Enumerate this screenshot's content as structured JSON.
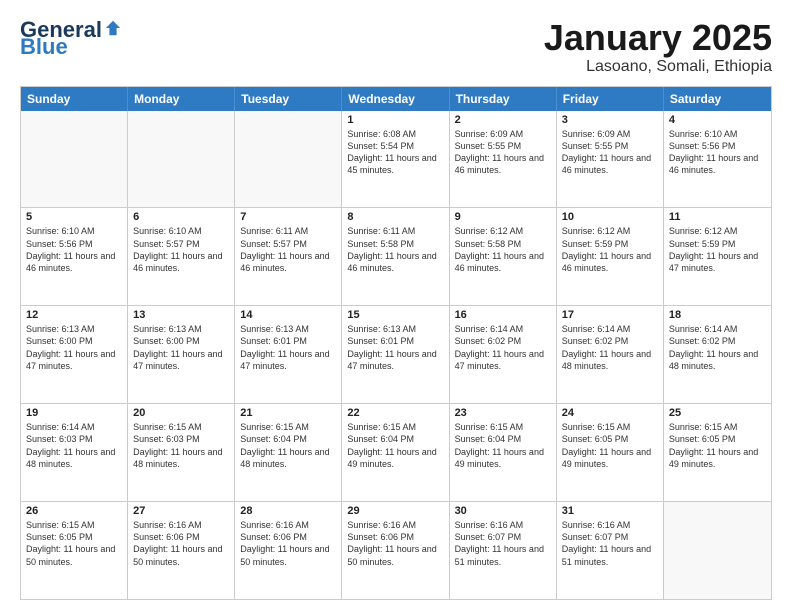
{
  "logo": {
    "general": "General",
    "blue": "Blue"
  },
  "header": {
    "month": "January 2025",
    "location": "Lasoano, Somali, Ethiopia"
  },
  "days": [
    "Sunday",
    "Monday",
    "Tuesday",
    "Wednesday",
    "Thursday",
    "Friday",
    "Saturday"
  ],
  "rows": [
    [
      {
        "day": "",
        "info": ""
      },
      {
        "day": "",
        "info": ""
      },
      {
        "day": "",
        "info": ""
      },
      {
        "day": "1",
        "info": "Sunrise: 6:08 AM\nSunset: 5:54 PM\nDaylight: 11 hours and 45 minutes."
      },
      {
        "day": "2",
        "info": "Sunrise: 6:09 AM\nSunset: 5:55 PM\nDaylight: 11 hours and 46 minutes."
      },
      {
        "day": "3",
        "info": "Sunrise: 6:09 AM\nSunset: 5:55 PM\nDaylight: 11 hours and 46 minutes."
      },
      {
        "day": "4",
        "info": "Sunrise: 6:10 AM\nSunset: 5:56 PM\nDaylight: 11 hours and 46 minutes."
      }
    ],
    [
      {
        "day": "5",
        "info": "Sunrise: 6:10 AM\nSunset: 5:56 PM\nDaylight: 11 hours and 46 minutes."
      },
      {
        "day": "6",
        "info": "Sunrise: 6:10 AM\nSunset: 5:57 PM\nDaylight: 11 hours and 46 minutes."
      },
      {
        "day": "7",
        "info": "Sunrise: 6:11 AM\nSunset: 5:57 PM\nDaylight: 11 hours and 46 minutes."
      },
      {
        "day": "8",
        "info": "Sunrise: 6:11 AM\nSunset: 5:58 PM\nDaylight: 11 hours and 46 minutes."
      },
      {
        "day": "9",
        "info": "Sunrise: 6:12 AM\nSunset: 5:58 PM\nDaylight: 11 hours and 46 minutes."
      },
      {
        "day": "10",
        "info": "Sunrise: 6:12 AM\nSunset: 5:59 PM\nDaylight: 11 hours and 46 minutes."
      },
      {
        "day": "11",
        "info": "Sunrise: 6:12 AM\nSunset: 5:59 PM\nDaylight: 11 hours and 47 minutes."
      }
    ],
    [
      {
        "day": "12",
        "info": "Sunrise: 6:13 AM\nSunset: 6:00 PM\nDaylight: 11 hours and 47 minutes."
      },
      {
        "day": "13",
        "info": "Sunrise: 6:13 AM\nSunset: 6:00 PM\nDaylight: 11 hours and 47 minutes."
      },
      {
        "day": "14",
        "info": "Sunrise: 6:13 AM\nSunset: 6:01 PM\nDaylight: 11 hours and 47 minutes."
      },
      {
        "day": "15",
        "info": "Sunrise: 6:13 AM\nSunset: 6:01 PM\nDaylight: 11 hours and 47 minutes."
      },
      {
        "day": "16",
        "info": "Sunrise: 6:14 AM\nSunset: 6:02 PM\nDaylight: 11 hours and 47 minutes."
      },
      {
        "day": "17",
        "info": "Sunrise: 6:14 AM\nSunset: 6:02 PM\nDaylight: 11 hours and 48 minutes."
      },
      {
        "day": "18",
        "info": "Sunrise: 6:14 AM\nSunset: 6:02 PM\nDaylight: 11 hours and 48 minutes."
      }
    ],
    [
      {
        "day": "19",
        "info": "Sunrise: 6:14 AM\nSunset: 6:03 PM\nDaylight: 11 hours and 48 minutes."
      },
      {
        "day": "20",
        "info": "Sunrise: 6:15 AM\nSunset: 6:03 PM\nDaylight: 11 hours and 48 minutes."
      },
      {
        "day": "21",
        "info": "Sunrise: 6:15 AM\nSunset: 6:04 PM\nDaylight: 11 hours and 48 minutes."
      },
      {
        "day": "22",
        "info": "Sunrise: 6:15 AM\nSunset: 6:04 PM\nDaylight: 11 hours and 49 minutes."
      },
      {
        "day": "23",
        "info": "Sunrise: 6:15 AM\nSunset: 6:04 PM\nDaylight: 11 hours and 49 minutes."
      },
      {
        "day": "24",
        "info": "Sunrise: 6:15 AM\nSunset: 6:05 PM\nDaylight: 11 hours and 49 minutes."
      },
      {
        "day": "25",
        "info": "Sunrise: 6:15 AM\nSunset: 6:05 PM\nDaylight: 11 hours and 49 minutes."
      }
    ],
    [
      {
        "day": "26",
        "info": "Sunrise: 6:15 AM\nSunset: 6:05 PM\nDaylight: 11 hours and 50 minutes."
      },
      {
        "day": "27",
        "info": "Sunrise: 6:16 AM\nSunset: 6:06 PM\nDaylight: 11 hours and 50 minutes."
      },
      {
        "day": "28",
        "info": "Sunrise: 6:16 AM\nSunset: 6:06 PM\nDaylight: 11 hours and 50 minutes."
      },
      {
        "day": "29",
        "info": "Sunrise: 6:16 AM\nSunset: 6:06 PM\nDaylight: 11 hours and 50 minutes."
      },
      {
        "day": "30",
        "info": "Sunrise: 6:16 AM\nSunset: 6:07 PM\nDaylight: 11 hours and 51 minutes."
      },
      {
        "day": "31",
        "info": "Sunrise: 6:16 AM\nSunset: 6:07 PM\nDaylight: 11 hours and 51 minutes."
      },
      {
        "day": "",
        "info": ""
      }
    ]
  ]
}
